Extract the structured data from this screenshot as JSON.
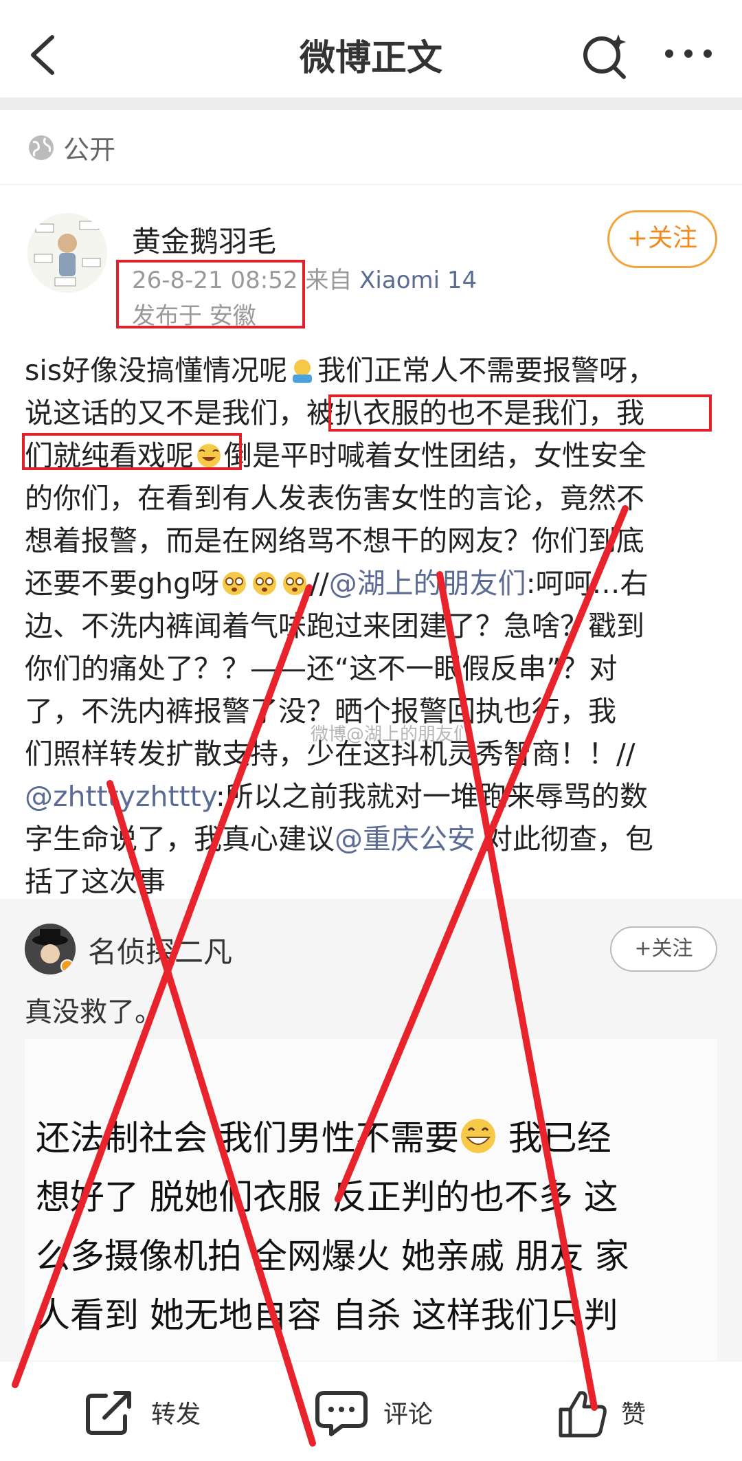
{
  "header": {
    "title": "微博正文",
    "back_icon": "chevron-left-icon",
    "search_icon": "search-sparkle-icon",
    "more_icon": "more-dots-icon"
  },
  "visibility": {
    "icon": "globe-icon",
    "label": "公开"
  },
  "post": {
    "author": "黄金鹅羽毛",
    "time": "26-8-21 08:52",
    "source_prefix": "来自",
    "source": "Xiaomi 14",
    "location": "发布于 安徽",
    "follow_label": "+关注",
    "lines": [
      "sis好像没搞懂情况呢",
      "我们正常人不需要报警呀，",
      "说这话的又不是我们，",
      "被扒衣服的也不是我们，我",
      "们就纯看戏呢",
      "倒是平时喊着女性团结，女性安全",
      "的你们，在看到有人发表伤害女性的言论，竟然不",
      "想着报警，而是在网络骂不想干的网友？你们到底",
      "还要不要ghg呀",
      "//",
      "@湖上的朋友们",
      ":呵呵…右",
      "边、不洗内裤闻着气味跑过来团建了？急啥？戳到",
      "你们的痛处了？？——还“这不一眼假反串”？对",
      "了，不洗内裤报警了没？晒个报警回执也行，我",
      "们照样转发扩散支持，少在这抖机灵秀智商！！//",
      "@zhtttyzhttty",
      ":所以之前我就对一堆跑来辱骂的数",
      "字生命说了，我真心建议",
      "@重庆公安",
      " 对此彻查，包",
      "括了这次事"
    ],
    "watermark": "微博@湖上的朋友们"
  },
  "repost": {
    "author": "名侦探二凡",
    "follow_label": "+关注",
    "text": "真没救了。",
    "image_lines": [
      "还法制社会 我们男性不需要",
      " 我已经",
      "想好了 脱她们衣服 反正判的也不多 这",
      "么多摄像机拍 全网爆火 她亲戚 朋友 家",
      "人看到 她无地自容 自杀 这样我们只判"
    ]
  },
  "bottom_bar": {
    "repost_label": "转发",
    "comment_label": "评论",
    "like_label": "赞"
  },
  "colors": {
    "accent_orange": "#f08a1f",
    "link_blue": "#5b6b93",
    "annotation_red": "#e0202a"
  }
}
